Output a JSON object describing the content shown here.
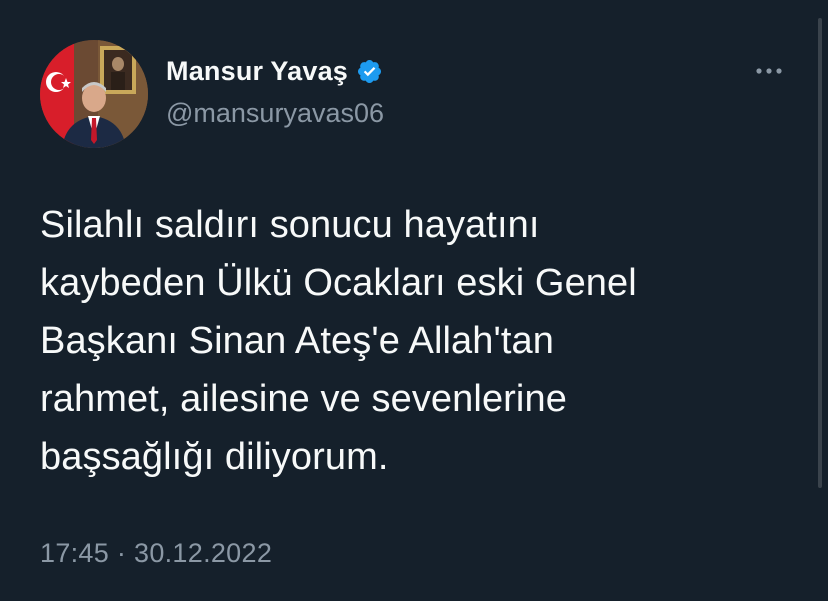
{
  "author": {
    "display_name": "Mansur Yavaş",
    "handle": "@mansuryavas06",
    "verified": true
  },
  "tweet": {
    "text": "Silahlı saldırı sonucu hayatını\nkaybeden Ülkü Ocakları eski Genel\nBaşkanı Sinan Ateş'e Allah'tan\nrahmet, ailesine ve sevenlerine\nbaşsağlığı diliyorum.",
    "time": "17:45",
    "separator": "·",
    "date": "30.12.2022"
  },
  "icons": {
    "verified": "verified-badge-icon",
    "more": "more-options-icon"
  },
  "colors": {
    "background": "#15202b",
    "primary_text": "#f7f9f9",
    "secondary_text": "#8b98a5",
    "verified_blue": "#1d9bf0"
  }
}
